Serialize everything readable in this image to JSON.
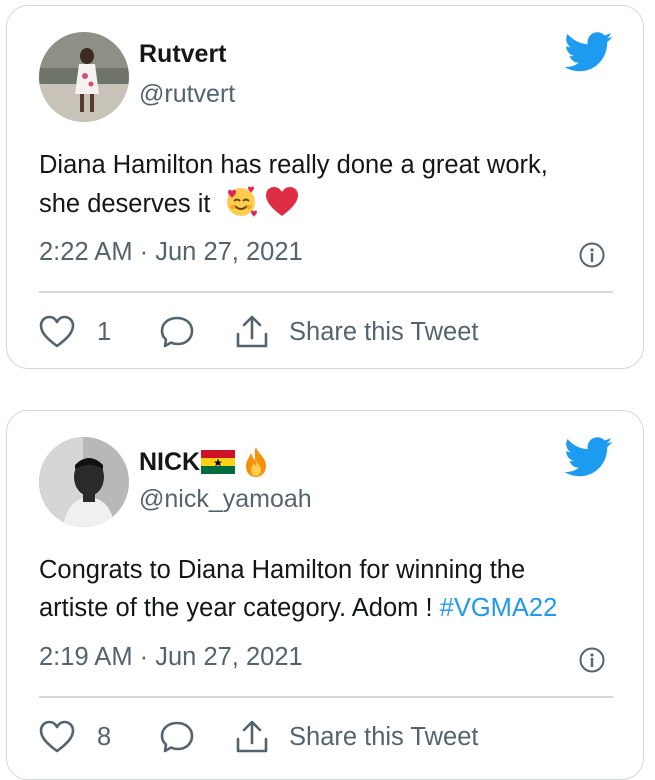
{
  "tweets": [
    {
      "display_name": "Rutvert",
      "handle": "@rutvert",
      "text_line1": "Diana Hamilton has really done a great work,",
      "text_line2": "she deserves it",
      "hashtag": "",
      "emojis": [
        "smiling-face-with-hearts",
        "red-heart"
      ],
      "time": "2:22 AM",
      "separator": "·",
      "date": "Jun 27, 2021",
      "likes": "1",
      "share_label": "Share this Tweet"
    },
    {
      "display_name": "NICK",
      "display_name_emojis": [
        "ghana-flag",
        "fire"
      ],
      "handle": "@nick_yamoah",
      "text_line1": "Congrats to Diana Hamilton for winning the",
      "text_line2": "artiste of the year category. Adom ! ",
      "hashtag": "#VGMA22",
      "time": "2:19 AM",
      "separator": "·",
      "date": "Jun 27, 2021",
      "likes": "8",
      "share_label": "Share this Tweet"
    }
  ],
  "colors": {
    "twitter_blue": "#1d9bf0",
    "secondary_text": "#536471",
    "border": "#cfd9de",
    "heart_red": "#e0245e"
  }
}
